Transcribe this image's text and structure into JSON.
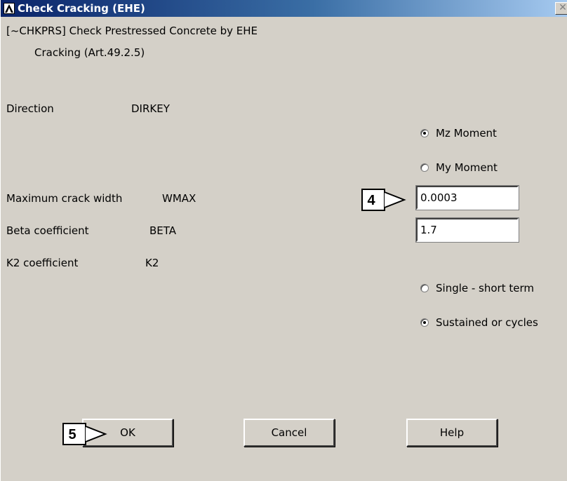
{
  "window": {
    "title": "Check Cracking (EHE)",
    "close_glyph": "✕"
  },
  "header": {
    "line1": "[~CHKPRS] Check Prestressed Concrete by EHE",
    "line2": "Cracking (Art.49.2.5)"
  },
  "fields": {
    "direction": {
      "label": "Direction",
      "key": "DIRKEY"
    },
    "wmax": {
      "label": "Maximum crack width",
      "key": "WMAX",
      "value": "0.0003"
    },
    "beta": {
      "label": "Beta coefficient",
      "key": "BETA",
      "value": "1.7"
    },
    "k2": {
      "label": "K2 coefficient",
      "key": "K2"
    }
  },
  "direction_options": [
    {
      "label": "Mz Moment",
      "checked": true
    },
    {
      "label": "My Moment",
      "checked": false
    }
  ],
  "k2_options": [
    {
      "label": "Single - short term",
      "checked": false
    },
    {
      "label": "Sustained or cycles",
      "checked": true
    }
  ],
  "buttons": {
    "ok": "OK",
    "cancel": "Cancel",
    "help": "Help"
  },
  "callouts": {
    "step4": "4",
    "step5": "5"
  }
}
